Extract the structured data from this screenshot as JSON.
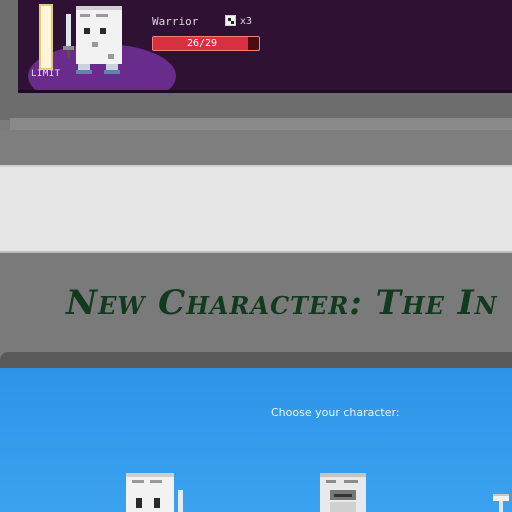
{
  "status_card": {
    "limit_label": "LIMIT",
    "name": "Warrior",
    "dice_icon": "dice-icon",
    "dice_count": "x3",
    "hp": {
      "current": 26,
      "max": 29,
      "text": "26/29"
    },
    "limit_fill": 1.0
  },
  "page": {
    "title": "New Character: The In"
  },
  "select_panel": {
    "prompt": "Choose your character:",
    "characters": [
      {
        "icon": "warrior-character-icon"
      },
      {
        "icon": "knight-character-icon"
      },
      {
        "icon": "hammer-character-icon"
      }
    ]
  },
  "colors": {
    "card_bg": "#2e1133",
    "hp_red": "#d93040",
    "title_green": "#123a1e",
    "panel_blue": "#2d95e6"
  }
}
